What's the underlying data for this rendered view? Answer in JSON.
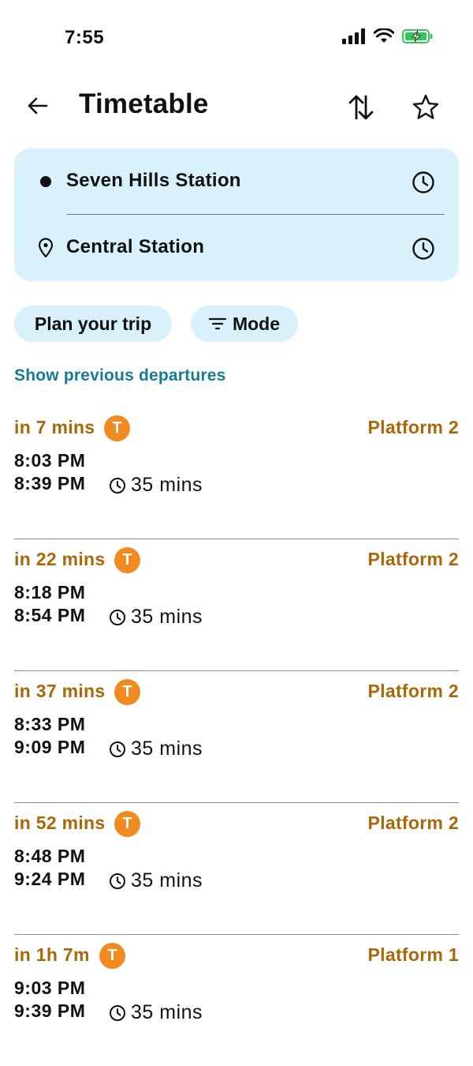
{
  "status_bar": {
    "time": "7:55"
  },
  "header": {
    "title": "Timetable"
  },
  "trip": {
    "origin": "Seven Hills Station",
    "destination": "Central Station"
  },
  "chips": {
    "plan": "Plan your trip",
    "mode": "Mode"
  },
  "previous_link": "Show previous departures",
  "departures": [
    {
      "eta": "in 7 mins",
      "mode": "T",
      "platform": "Platform 2",
      "depart": "8:03 PM",
      "arrive": "8:39 PM",
      "duration": "35 mins"
    },
    {
      "eta": "in 22 mins",
      "mode": "T",
      "platform": "Platform 2",
      "depart": "8:18 PM",
      "arrive": "8:54 PM",
      "duration": "35 mins"
    },
    {
      "eta": "in 37 mins",
      "mode": "T",
      "platform": "Platform 2",
      "depart": "8:33 PM",
      "arrive": "9:09 PM",
      "duration": "35 mins"
    },
    {
      "eta": "in 52 mins",
      "mode": "T",
      "platform": "Platform 2",
      "depart": "8:48 PM",
      "arrive": "9:24 PM",
      "duration": "35 mins"
    },
    {
      "eta": "in 1h 7m",
      "mode": "T",
      "platform": "Platform 1",
      "depart": "9:03 PM",
      "arrive": "9:39 PM",
      "duration": "35 mins"
    }
  ],
  "colors": {
    "accent_card": "#d9f1fb",
    "eta_text": "#a86708",
    "train_badge": "#f18a20",
    "link": "#177a94"
  },
  "icons": {
    "back": "arrow-left-icon",
    "swap": "swap-vertical-icon",
    "favourite": "star-outline-icon",
    "origin": "dot-icon",
    "destination": "location-pin-icon",
    "time": "clock-icon",
    "filter": "filter-icon"
  }
}
